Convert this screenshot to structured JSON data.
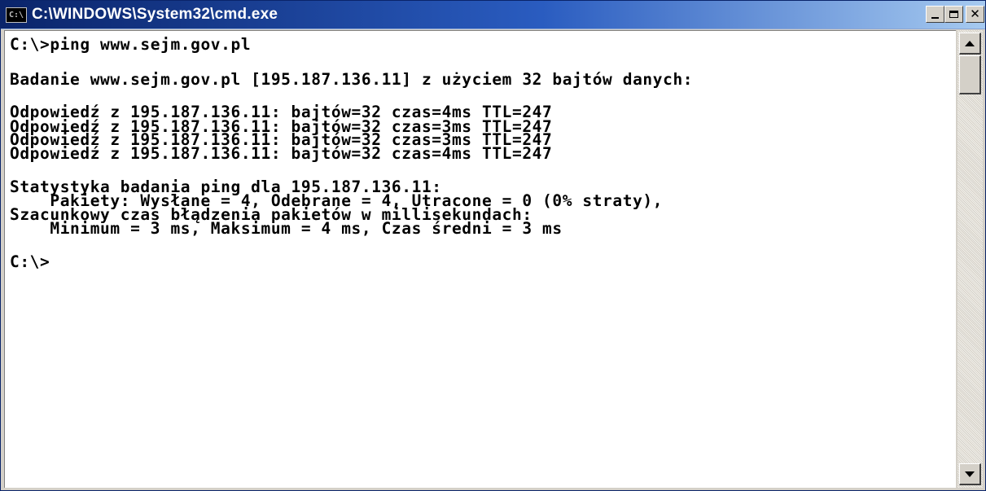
{
  "window": {
    "title": "C:\\WINDOWS\\System32\\cmd.exe",
    "icon": "cmd-icon",
    "icon_text": "C:\\",
    "controls": {
      "minimize": "minimize-icon",
      "maximize": "maximize-icon",
      "close": "close-icon",
      "close_glyph": "✕"
    }
  },
  "console": {
    "lines": [
      "C:\\>ping www.sejm.gov.pl",
      "",
      "Badanie www.sejm.gov.pl [195.187.136.11] z użyciem 32 bajtów danych:",
      "",
      "Odpowiedź z 195.187.136.11: bajtów=32 czas=4ms TTL=247",
      "Odpowiedź z 195.187.136.11: bajtów=32 czas=3ms TTL=247",
      "Odpowiedź z 195.187.136.11: bajtów=32 czas=3ms TTL=247",
      "Odpowiedź z 195.187.136.11: bajtów=32 czas=4ms TTL=247",
      "",
      "Statystyka badania ping dla 195.187.136.11:",
      "    Pakiety: Wysłane = 4, Odebrane = 4, Utracone = 0 (0% straty),",
      "Szacunkowy czas błądzenia pakietów w millisekundach:",
      "    Minimum = 3 ms, Maksimum = 4 ms, Czas średni = 3 ms",
      "",
      "C:\\>"
    ]
  },
  "scrollbar": {
    "up_icon": "scroll-up-arrow-icon",
    "down_icon": "scroll-down-arrow-icon"
  },
  "colors": {
    "titlebar_start": "#0a246a",
    "titlebar_end": "#a6caf0",
    "console_bg": "#ffffff",
    "console_text": "#000000"
  }
}
